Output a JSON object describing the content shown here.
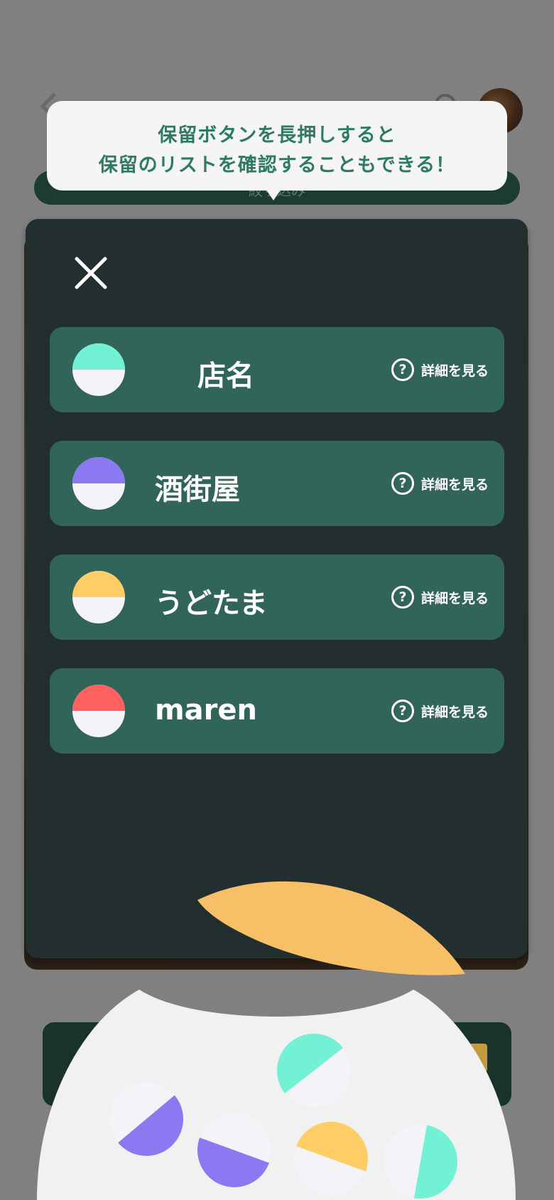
{
  "tooltip": {
    "line1": "保留ボタンを長押しすると",
    "line2": "保留のリストを確認することもできる！"
  },
  "background": {
    "filter_bar_text": "絞り込み"
  },
  "modal": {
    "close_icon": "close-icon",
    "items": [
      {
        "name": "店名",
        "color": "#72f1d4",
        "detail_label": "詳細を見る",
        "icon": "help-circle-icon"
      },
      {
        "name": "酒街屋",
        "color": "#8b79f2",
        "detail_label": "詳細を見る",
        "icon": "help-circle-icon"
      },
      {
        "name": "うどたま",
        "color": "#ffcd66",
        "detail_label": "詳細を見る",
        "icon": "help-circle-icon"
      },
      {
        "name": "maren",
        "color": "#ff6161",
        "detail_label": "詳細を見る",
        "icon": "help-circle-icon"
      }
    ]
  },
  "colors": {
    "modal_bg": "#232e2f",
    "item_bg": "#32655a",
    "tooltip_text": "#2e7b62",
    "tooltip_bg": "#f5f5f7",
    "bowl": "#f1f1f2",
    "lid": "#f7bf66"
  }
}
